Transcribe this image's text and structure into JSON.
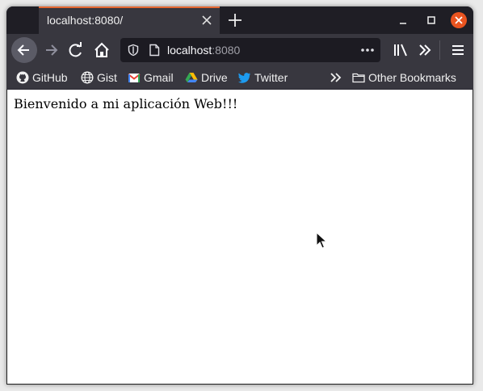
{
  "tab": {
    "title": "localhost:8080/"
  },
  "urlbar": {
    "host": "localhost",
    "port": ":8080"
  },
  "bookmarks": [
    {
      "label": "GitHub",
      "icon": "github-icon"
    },
    {
      "label": "Gist",
      "icon": "globe-icon"
    },
    {
      "label": "Gmail",
      "icon": "gmail-icon"
    },
    {
      "label": "Drive",
      "icon": "drive-icon"
    },
    {
      "label": "Twitter",
      "icon": "twitter-icon"
    },
    {
      "label": "Other Bookmarks",
      "icon": "folder-icon"
    }
  ],
  "page": {
    "text": "Bienvenido a mi aplicación Web!!!"
  },
  "colors": {
    "accent": "#e66832",
    "close": "#e95420",
    "toolbar": "#38373f"
  }
}
